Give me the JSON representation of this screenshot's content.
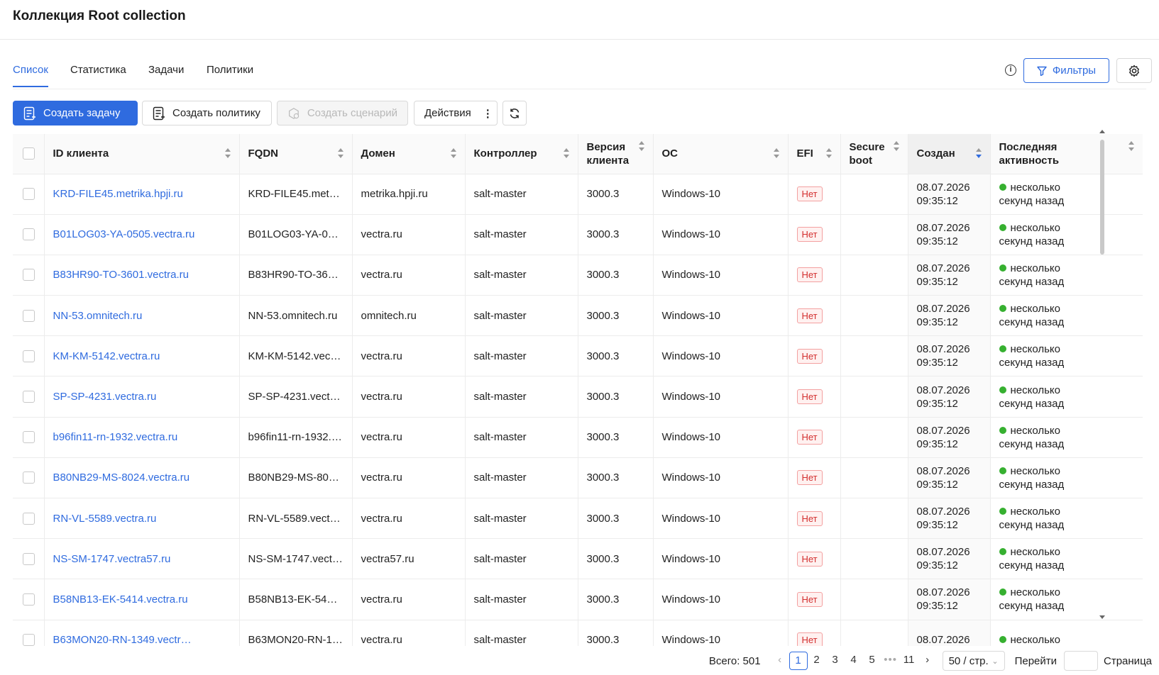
{
  "page": {
    "title": "Коллекция Root collection"
  },
  "tabs": [
    {
      "label": "Список",
      "active": true
    },
    {
      "label": "Статистика",
      "active": false
    },
    {
      "label": "Задачи",
      "active": false
    },
    {
      "label": "Политики",
      "active": false
    }
  ],
  "tools": {
    "info_icon": "info-icon",
    "filters_label": "Фильтры",
    "settings_icon": "gear-icon"
  },
  "toolbar": {
    "create_task": "Создать задачу",
    "create_policy": "Создать политику",
    "create_scenario": "Создать сценарий",
    "actions": "Действия",
    "refresh_icon": "refresh-icon"
  },
  "table": {
    "columns": [
      "ID клиента",
      "FQDN",
      "Домен",
      "Контроллер",
      "Версия клиента",
      "ОС",
      "EFI",
      "Secure boot",
      "Создан",
      "Последняя активность"
    ],
    "sorted_column": "Создан",
    "rows": [
      {
        "id": "KRD-FILE45.metrika.hpji.ru",
        "fqdn": "KRD-FILE45.metri…",
        "domain": "metrika.hpji.ru",
        "controller": "salt-master",
        "version": "3000.3",
        "os": "Windows-10",
        "efi": "Нет",
        "secure_boot": "",
        "created_date": "08.07.2026",
        "created_time": "09:35:12",
        "activity_1": "несколько",
        "activity_2": "секунд назад"
      },
      {
        "id": "B01LOG03-YA-0505.vectra.ru",
        "fqdn": "B01LOG03-YA-05…",
        "domain": "vectra.ru",
        "controller": "salt-master",
        "version": "3000.3",
        "os": "Windows-10",
        "efi": "Нет",
        "secure_boot": "",
        "created_date": "08.07.2026",
        "created_time": "09:35:12",
        "activity_1": "несколько",
        "activity_2": "секунд назад"
      },
      {
        "id": "B83HR90-TO-3601.vectra.ru",
        "fqdn": "B83HR90-TO-360…",
        "domain": "vectra.ru",
        "controller": "salt-master",
        "version": "3000.3",
        "os": "Windows-10",
        "efi": "Нет",
        "secure_boot": "",
        "created_date": "08.07.2026",
        "created_time": "09:35:12",
        "activity_1": "несколько",
        "activity_2": "секунд назад"
      },
      {
        "id": "NN-53.omnitech.ru",
        "fqdn": "NN-53.omnitech.ru",
        "domain": "omnitech.ru",
        "controller": "salt-master",
        "version": "3000.3",
        "os": "Windows-10",
        "efi": "Нет",
        "secure_boot": "",
        "created_date": "08.07.2026",
        "created_time": "09:35:12",
        "activity_1": "несколько",
        "activity_2": "секунд назад"
      },
      {
        "id": "KM-KM-5142.vectra.ru",
        "fqdn": "KM-KM-5142.vect…",
        "domain": "vectra.ru",
        "controller": "salt-master",
        "version": "3000.3",
        "os": "Windows-10",
        "efi": "Нет",
        "secure_boot": "",
        "created_date": "08.07.2026",
        "created_time": "09:35:12",
        "activity_1": "несколько",
        "activity_2": "секунд назад"
      },
      {
        "id": "SP-SP-4231.vectra.ru",
        "fqdn": "SP-SP-4231.vectr…",
        "domain": "vectra.ru",
        "controller": "salt-master",
        "version": "3000.3",
        "os": "Windows-10",
        "efi": "Нет",
        "secure_boot": "",
        "created_date": "08.07.2026",
        "created_time": "09:35:12",
        "activity_1": "несколько",
        "activity_2": "секунд назад"
      },
      {
        "id": "b96fin11-rn-1932.vectra.ru",
        "fqdn": "b96fin11-rn-1932.v…",
        "domain": "vectra.ru",
        "controller": "salt-master",
        "version": "3000.3",
        "os": "Windows-10",
        "efi": "Нет",
        "secure_boot": "",
        "created_date": "08.07.2026",
        "created_time": "09:35:12",
        "activity_1": "несколько",
        "activity_2": "секунд назад"
      },
      {
        "id": "B80NB29-MS-8024.vectra.ru",
        "fqdn": "B80NB29-MS-802…",
        "domain": "vectra.ru",
        "controller": "salt-master",
        "version": "3000.3",
        "os": "Windows-10",
        "efi": "Нет",
        "secure_boot": "",
        "created_date": "08.07.2026",
        "created_time": "09:35:12",
        "activity_1": "несколько",
        "activity_2": "секунд назад"
      },
      {
        "id": "RN-VL-5589.vectra.ru",
        "fqdn": "RN-VL-5589.vectr…",
        "domain": "vectra.ru",
        "controller": "salt-master",
        "version": "3000.3",
        "os": "Windows-10",
        "efi": "Нет",
        "secure_boot": "",
        "created_date": "08.07.2026",
        "created_time": "09:35:12",
        "activity_1": "несколько",
        "activity_2": "секунд назад"
      },
      {
        "id": "NS-SM-1747.vectra57.ru",
        "fqdn": "NS-SM-1747.vect…",
        "domain": "vectra57.ru",
        "controller": "salt-master",
        "version": "3000.3",
        "os": "Windows-10",
        "efi": "Нет",
        "secure_boot": "",
        "created_date": "08.07.2026",
        "created_time": "09:35:12",
        "activity_1": "несколько",
        "activity_2": "секунд назад"
      },
      {
        "id": "B58NB13-EK-5414.vectra.ru",
        "fqdn": "B58NB13-EK-541…",
        "domain": "vectra.ru",
        "controller": "salt-master",
        "version": "3000.3",
        "os": "Windows-10",
        "efi": "Нет",
        "secure_boot": "",
        "created_date": "08.07.2026",
        "created_time": "09:35:12",
        "activity_1": "несколько",
        "activity_2": "секунд назад"
      },
      {
        "id": "B63MON20-RN-1349.vectr…",
        "fqdn": "B63MON20-RN-1…",
        "domain": "vectra.ru",
        "controller": "salt-master",
        "version": "3000.3",
        "os": "Windows-10",
        "efi": "Нет",
        "secure_boot": "",
        "created_date": "08.07.2026",
        "created_time": "",
        "activity_1": "несколько",
        "activity_2": ""
      }
    ]
  },
  "pagination": {
    "total": "Всего: 501",
    "pages": [
      "1",
      "2",
      "3",
      "4",
      "5",
      "•••",
      "11"
    ],
    "current": "1",
    "page_size": "50 / стр.",
    "goto_label": "Перейти",
    "page_label": "Страница"
  },
  "colors": {
    "accent": "#2f6bdf",
    "online": "#36b030",
    "tag_red": "#d32f2f"
  }
}
